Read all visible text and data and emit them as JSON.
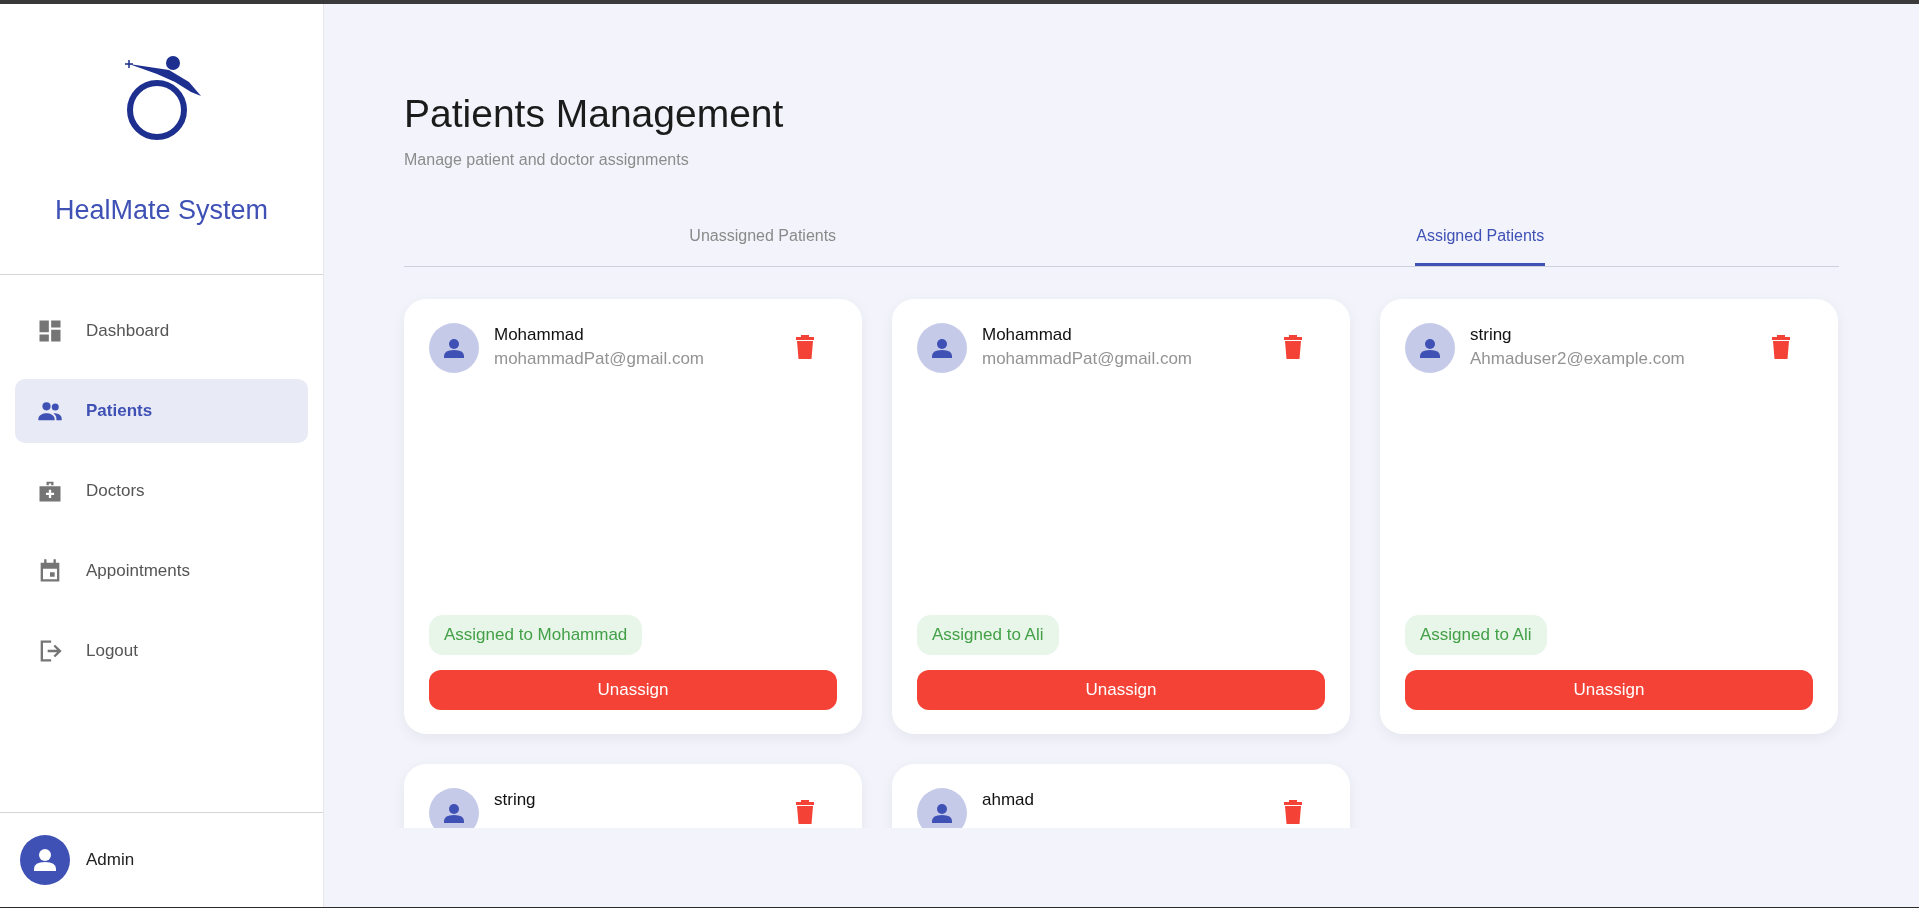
{
  "sidebar": {
    "app_title": "HealMate System",
    "items": [
      {
        "label": "Dashboard",
        "selected": false
      },
      {
        "label": "Patients",
        "selected": true
      },
      {
        "label": "Doctors",
        "selected": false
      },
      {
        "label": "Appointments",
        "selected": false
      },
      {
        "label": "Logout",
        "selected": false
      }
    ],
    "user": {
      "name": "Admin"
    }
  },
  "page": {
    "title": "Patients Management",
    "subtitle": "Manage patient and doctor assignments"
  },
  "tabs": [
    {
      "label": "Unassigned Patients",
      "selected": false
    },
    {
      "label": "Assigned Patients",
      "selected": true
    }
  ],
  "cards": [
    {
      "name": "Mohammad",
      "email": "mohammadPat@gmail.com",
      "assignment": "Assigned to Mohammad",
      "button": "Unassign"
    },
    {
      "name": "Mohammad",
      "email": "mohammadPat@gmail.com",
      "assignment": "Assigned to Ali",
      "button": "Unassign"
    },
    {
      "name": "string",
      "email": "Ahmaduser2@example.com",
      "assignment": "Assigned to Ali",
      "button": "Unassign"
    },
    {
      "name": "string"
    },
    {
      "name": "ahmad"
    }
  ]
}
